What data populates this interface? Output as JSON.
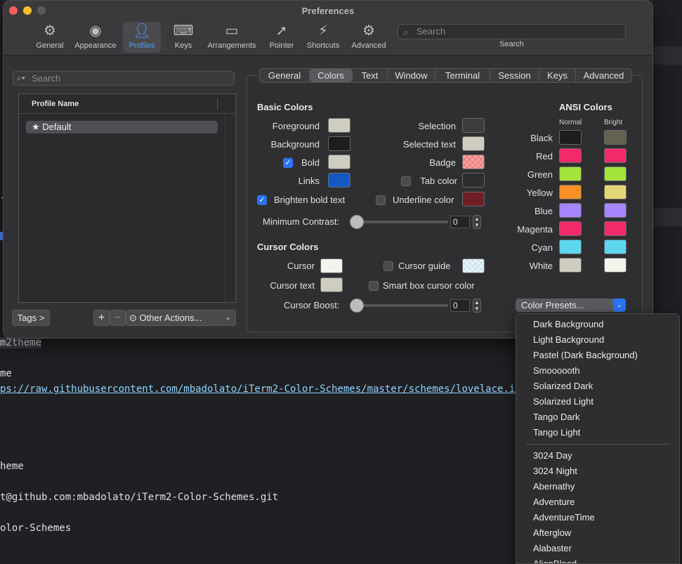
{
  "window": {
    "title": "Preferences"
  },
  "toolbar": {
    "items": [
      {
        "label": "General"
      },
      {
        "label": "Appearance"
      },
      {
        "label": "Profiles"
      },
      {
        "label": "Keys"
      },
      {
        "label": "Arrangements"
      },
      {
        "label": "Pointer"
      },
      {
        "label": "Shortcuts"
      },
      {
        "label": "Advanced"
      }
    ],
    "search_placeholder": "Search",
    "search_label": "Search"
  },
  "profiles": {
    "search_placeholder": "Search",
    "column_header": "Profile Name",
    "rows": [
      {
        "name": "Default"
      }
    ],
    "tags_button": "Tags >",
    "add_button": "+",
    "remove_button": "−",
    "other_actions": "Other Actions..."
  },
  "tabs": [
    "General",
    "Colors",
    "Text",
    "Window",
    "Terminal",
    "Session",
    "Keys",
    "Advanced"
  ],
  "basic_colors": {
    "title": "Basic Colors",
    "foreground": "Foreground",
    "background": "Background",
    "bold": "Bold",
    "links": "Links",
    "selection": "Selection",
    "selected_text": "Selected text",
    "badge": "Badge",
    "tab_color": "Tab color",
    "brighten_bold": "Brighten bold text",
    "underline_color": "Underline color",
    "min_contrast_label": "Minimum Contrast:",
    "min_contrast_value": "0",
    "swatches": {
      "foreground": "#cfcdbf",
      "background": "#1d1d1f",
      "bold": "#cfcdbf",
      "links": "#1458c4",
      "selection": "#3d3d40",
      "selected_text": "#cfcdbf",
      "badge": "#f08080",
      "tab_color": "#2c2c2e",
      "underline": "#6e2026"
    }
  },
  "cursor_colors": {
    "title": "Cursor Colors",
    "cursor": "Cursor",
    "cursor_text": "Cursor text",
    "cursor_guide": "Cursor guide",
    "smart_box": "Smart box cursor color",
    "boost_label": "Cursor Boost:",
    "boost_value": "0",
    "swatches": {
      "cursor": "#f5f4ec",
      "cursor_text": "#cfcdbf",
      "cursor_guide": "#cfe4ef"
    }
  },
  "ansi": {
    "title": "ANSI Colors",
    "normal_label": "Normal",
    "bright_label": "Bright",
    "rows": [
      {
        "name": "Black",
        "normal": "#1d1d1f",
        "bright": "#636050"
      },
      {
        "name": "Red",
        "normal": "#f22a6a",
        "bright": "#f22a6a"
      },
      {
        "name": "Green",
        "normal": "#a4e23c",
        "bright": "#a4e23c"
      },
      {
        "name": "Yellow",
        "normal": "#fb8f27",
        "bright": "#e2d576"
      },
      {
        "name": "Blue",
        "normal": "#a685ff",
        "bright": "#a685ff"
      },
      {
        "name": "Magenta",
        "normal": "#f22a6a",
        "bright": "#f22a6a"
      },
      {
        "name": "Cyan",
        "normal": "#5dd7ee",
        "bright": "#5dd7ee"
      },
      {
        "name": "White",
        "normal": "#cfcdbf",
        "bright": "#f5f4ec"
      }
    ]
  },
  "presets": {
    "button_label": "Color Presets...",
    "group1": [
      "Dark Background",
      "Light Background",
      "Pastel (Dark Background)",
      "Smoooooth",
      "Solarized Dark",
      "Solarized Light",
      "Tango Dark",
      "Tango Light"
    ],
    "group2": [
      "3024 Day",
      "3024 Night",
      "Abernathy",
      "Adventure",
      "AdventureTime",
      "Afterglow",
      "Alabaster",
      "AlienBlood"
    ]
  },
  "terminal": {
    "lines": [
      "m2theme",
      "me",
      "ps://raw.githubusercontent.com/mbadolato/iTerm2-Color-Schemes/master/schemes/lovelace.itermc",
      "heme",
      "t@github.com:mbadolato/iTerm2-Color-Schemes.git",
      "olor-Schemes"
    ]
  },
  "colors": {
    "accent": "#2a74f2",
    "close": "#ff5f57",
    "minimize": "#febc2e",
    "zoom": "#5a5a5d"
  }
}
